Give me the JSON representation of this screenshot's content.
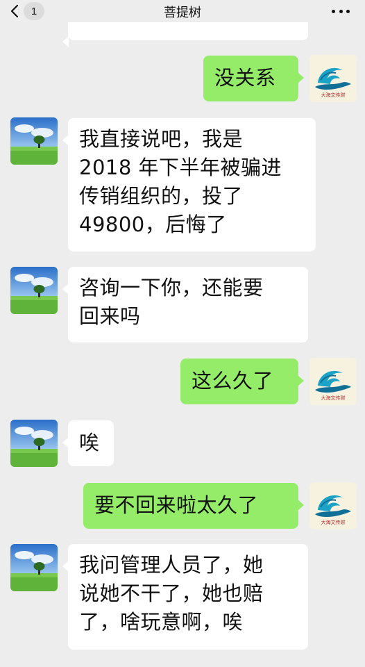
{
  "header": {
    "title": "菩提树",
    "unread_badge": "1",
    "back_icon": "chevron-left-icon",
    "more_icon": "more-dots-icon"
  },
  "messages": [
    {
      "from": "friend",
      "text": ""
    },
    {
      "from": "me",
      "text": "没关系"
    },
    {
      "from": "friend",
      "lines": [
        "我直接说吧，我是",
        "2018 年下半年被骗进",
        "传销组织的，投了",
        "49800，后悔了"
      ]
    },
    {
      "from": "friend",
      "lines": [
        "咨询一下你，还能要",
        "回来吗"
      ]
    },
    {
      "from": "me",
      "text": "这么久了"
    },
    {
      "from": "friend",
      "text": "唉"
    },
    {
      "from": "me",
      "text": "要不回来啦太久了"
    },
    {
      "from": "friend",
      "lines": [
        "我问管理人员了，她",
        "说她不干了，她也赔",
        "了，啥玩意啊，唉"
      ]
    }
  ],
  "my_avatar": {
    "caption": "大海文传财",
    "colors": {
      "wave": "#1aa3c6",
      "wave_dark": "#0f6f96",
      "bg": "#f7f2df"
    }
  },
  "friend_avatar": {
    "colors": {
      "sky": "#3d84d6",
      "grass": "#5fb33b",
      "tree": "#2d6b22"
    }
  },
  "colors": {
    "background": "#ededed",
    "bubble_in": "#ffffff",
    "bubble_out": "#95ec69"
  }
}
